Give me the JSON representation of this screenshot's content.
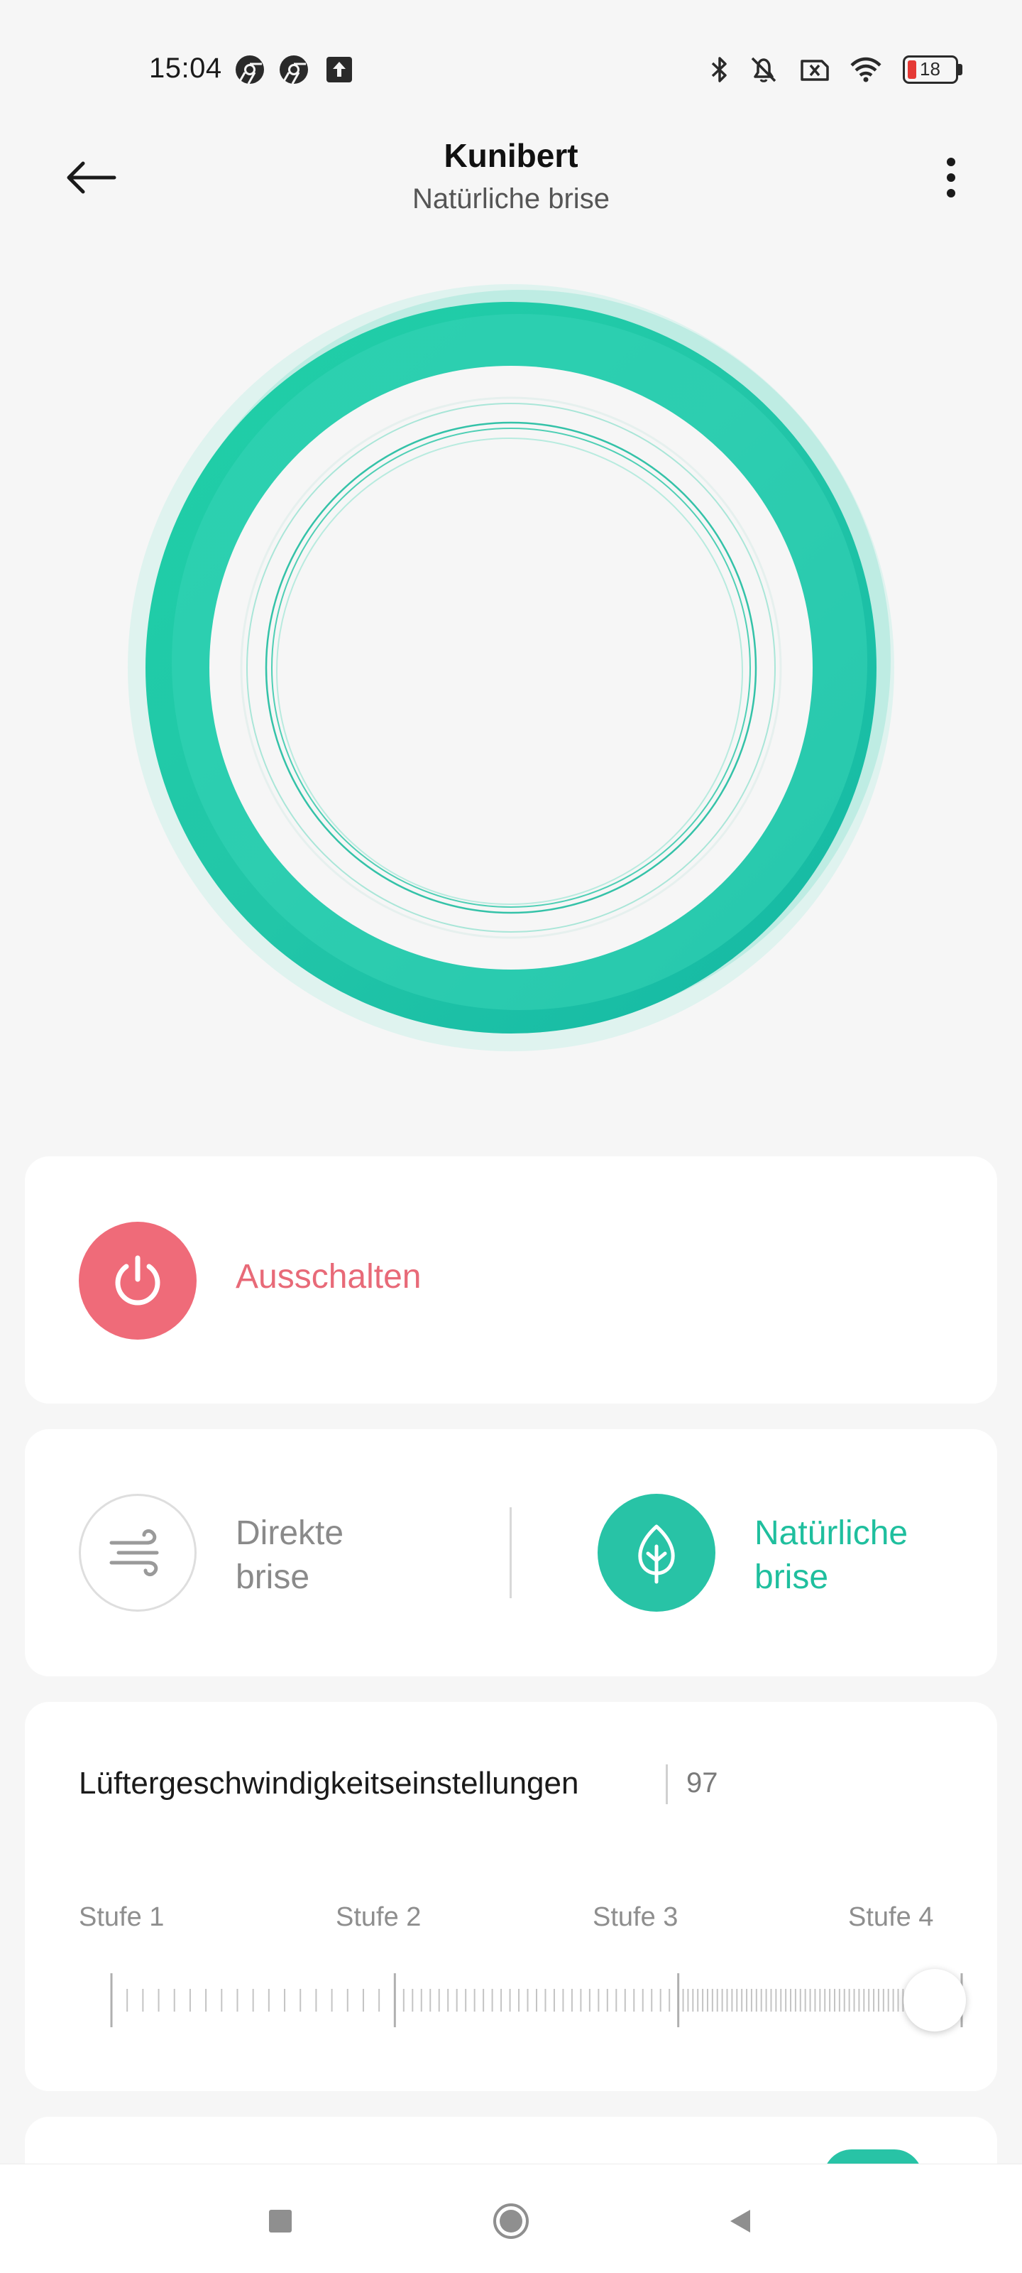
{
  "status_bar": {
    "time": "15:04",
    "battery_level": "18",
    "left_icons": [
      "chrome-icon",
      "chrome-icon",
      "upload-icon"
    ],
    "right_icons": [
      "bluetooth-icon",
      "mute-icon",
      "sim-off-icon",
      "wifi-icon",
      "battery-icon"
    ]
  },
  "header": {
    "title": "Kunibert",
    "subtitle": "Natürliche brise"
  },
  "power": {
    "label": "Ausschalten",
    "color": "#ef6b79"
  },
  "modes": {
    "direct": {
      "line1": "Direkte",
      "line2": "brise",
      "active": false
    },
    "natural": {
      "line1": "Natürliche",
      "line2": "brise",
      "active": true
    }
  },
  "speed": {
    "title": "Lüftergeschwindigkeitseinstellungen",
    "value": "97",
    "level_percent": 97,
    "steps": [
      "Stufe 1",
      "Stufe 2",
      "Stufe 3",
      "Stufe 4"
    ]
  },
  "colors": {
    "accent": "#28c3a6",
    "power_red": "#ef6b79"
  }
}
